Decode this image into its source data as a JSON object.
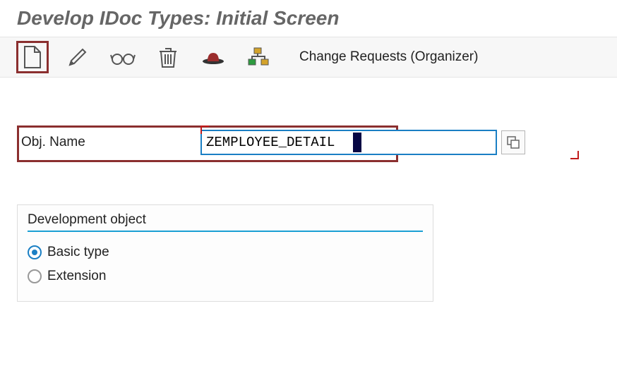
{
  "title": "Develop IDoc Types: Initial Screen",
  "toolbar": {
    "link_label": "Change Requests (Organizer)"
  },
  "form": {
    "obj_name_label": "Obj. Name",
    "obj_name_value": "ZEMPLOYEE_DETAIL"
  },
  "group": {
    "title": "Development object",
    "option1": "Basic type",
    "option2": "Extension",
    "selected": "Basic type"
  }
}
